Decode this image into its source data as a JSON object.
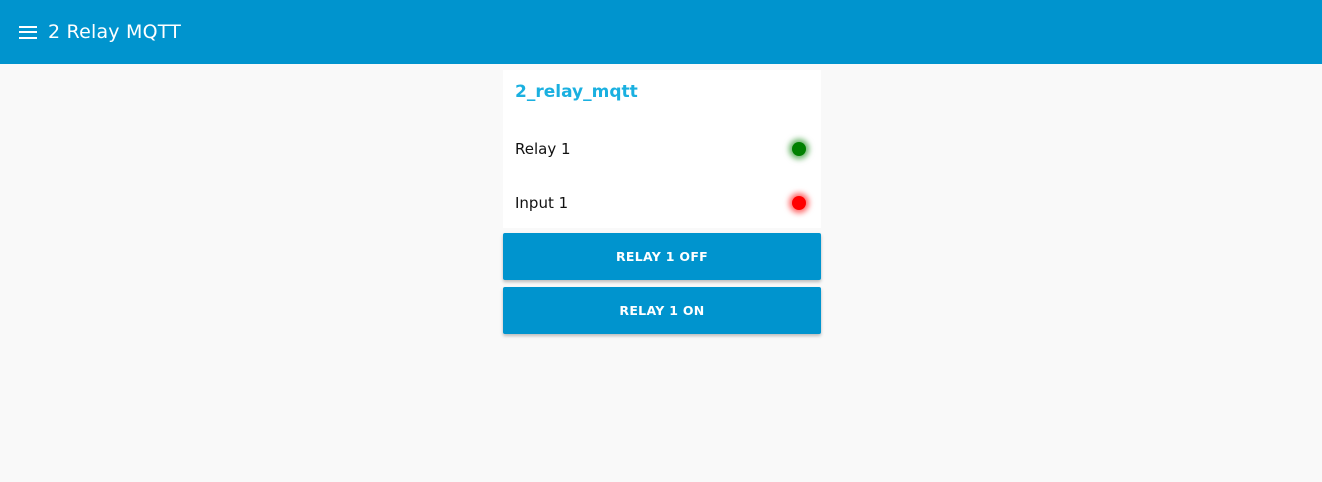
{
  "header": {
    "title": "2 Relay MQTT",
    "menu_icon": "hamburger-menu-icon",
    "background": "#0094ce"
  },
  "group": {
    "title": "2_relay_mqtt",
    "title_color": "#1ab0e0",
    "rows": [
      {
        "label": "Relay 1",
        "indicator_color": "#008000",
        "indicator_glow": "#00800099"
      },
      {
        "label": "Input 1",
        "indicator_color": "#ff0000",
        "indicator_glow": "#ff000099"
      }
    ]
  },
  "buttons": [
    {
      "label": "RELAY 1 OFF"
    },
    {
      "label": "RELAY 1 ON"
    }
  ]
}
